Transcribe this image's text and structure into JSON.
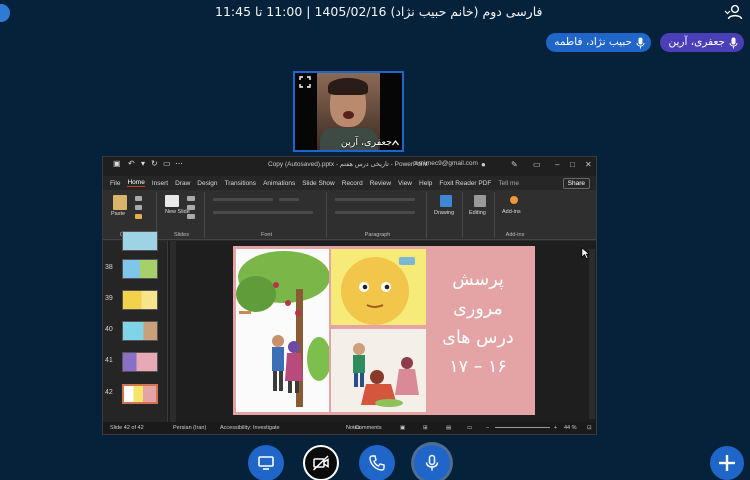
{
  "header": {
    "meeting_title": "فارسی دوم (خانم حبیب نژاد) 1405/02/16 | 11:00 تا 11:45"
  },
  "talkers": [
    {
      "name": "جعفری، آرین"
    },
    {
      "name": "حبیب نژاد، فاطمه"
    }
  ],
  "webcam": {
    "user_name": "جعفری، آرین"
  },
  "powerpoint": {
    "window_title": "Copy (Autosaved).pptx - تاریخی درس هفتم - PowerPoint",
    "account": "omirnec9@gmail.com",
    "tabs": [
      "File",
      "Home",
      "Insert",
      "Draw",
      "Design",
      "Transitions",
      "Animations",
      "Slide Show",
      "Record",
      "Review",
      "View",
      "Help",
      "Foxit Reader PDF",
      "Tell me"
    ],
    "share_label": "Share",
    "ribbon_groups": {
      "clipboard": "Clipboard",
      "paste": "Paste",
      "slides": "Slides",
      "new_slide": "New Slide",
      "font": "Font",
      "paragraph": "Paragraph",
      "drawing": "Drawing",
      "editing": "Editing",
      "addins_button": "Add-ins",
      "addins_label": "Add-ins"
    },
    "thumbnails": [
      {
        "num": "38"
      },
      {
        "num": "39"
      },
      {
        "num": "40"
      },
      {
        "num": "41"
      },
      {
        "num": "42"
      }
    ],
    "slide_text": [
      "پرسش",
      "مروری",
      "درس های",
      "۱۶ – ۱۷"
    ],
    "status": {
      "slide_of": "Slide 42 of 42",
      "language": "Persian (Iran)",
      "accessibility": "Accessibility: Investigate",
      "notes": "Notes",
      "comments": "Comments",
      "zoom": "44 %"
    }
  },
  "colors": {
    "background": "#06223a",
    "primary_button": "#1f66c8",
    "talker_active": "#4b3fb8",
    "slide_bg": "#e4a4a6"
  }
}
